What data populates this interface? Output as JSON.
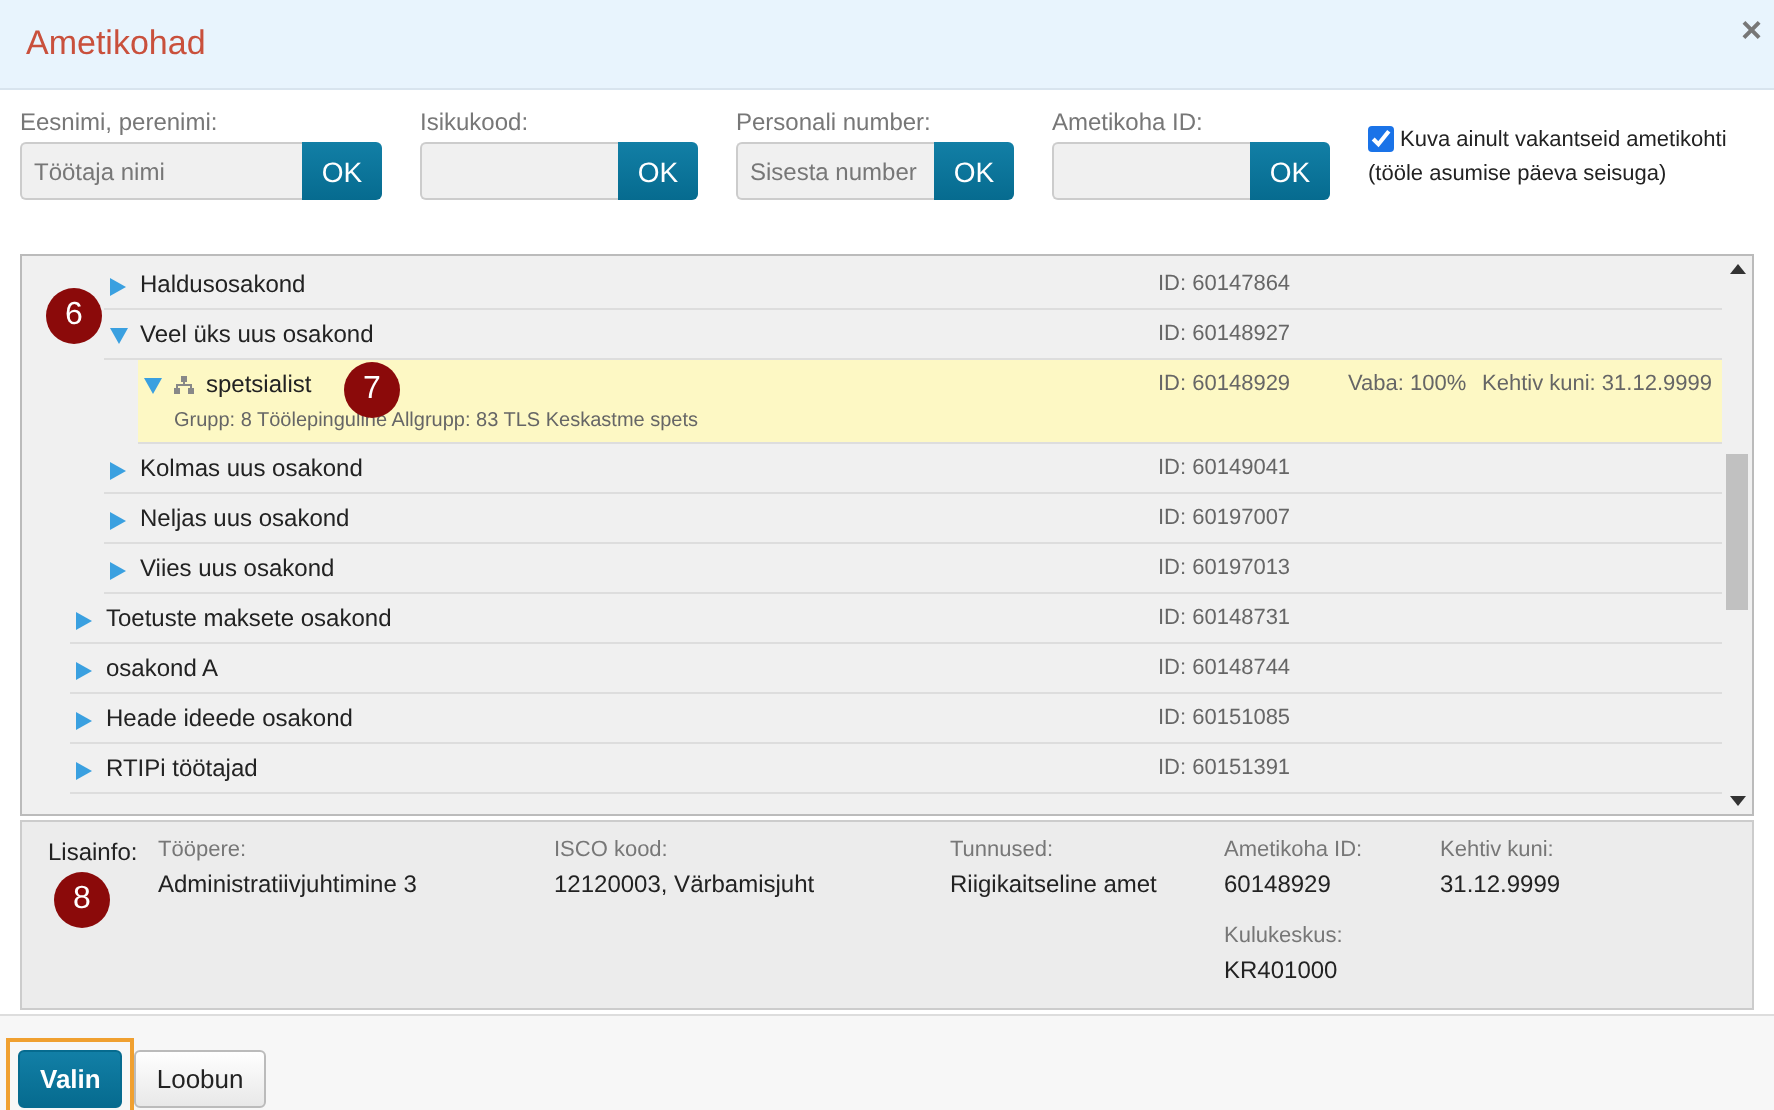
{
  "window": {
    "title": "Ametikohad",
    "close": "×"
  },
  "filters": [
    {
      "label": "Eesnimi, perenimi:",
      "placeholder": "Töötaja nimi",
      "button": "OK"
    },
    {
      "label": "Isikukood:",
      "button": "OK"
    },
    {
      "label": "Personali number:",
      "placeholder": "Sisesta number",
      "button": "OK"
    },
    {
      "label": "Ametikoha ID:",
      "button": "OK"
    }
  ],
  "vacant_only": {
    "label": "Kuva ainult vakantseid ametikohti",
    "note": "(tööle asumise päeva seisuga)",
    "checked": true
  },
  "tree": {
    "continued_items": [
      {
        "kind": "unit",
        "label": "Haldusosakond",
        "id": "ID: 60147864",
        "expanded": false,
        "selected": false
      },
      {
        "kind": "unit",
        "label": "Veel üks uus osakond",
        "id": "ID: 60148927",
        "expanded": true,
        "selected": false,
        "children": [
          {
            "kind": "position",
            "label": "spetsialist",
            "id": "ID: 60148929",
            "vacancy": "Vaba: 100%",
            "valid_until": "Kehtiv kuni: 31.12.9999",
            "details": "Grupp: 8 Töölepinguline Allgrupp: 83 TLS Keskastme spets",
            "expanded": true,
            "selected": true
          }
        ]
      },
      {
        "kind": "unit",
        "label": "Kolmas uus osakond",
        "id": "ID: 60149041",
        "expanded": false,
        "selected": false
      },
      {
        "kind": "unit",
        "label": "Neljas uus osakond",
        "id": "ID: 60197007",
        "expanded": false,
        "selected": false
      },
      {
        "kind": "unit",
        "label": "Viies uus osakond",
        "id": "ID: 60197013",
        "expanded": false,
        "selected": false
      }
    ],
    "items": [
      {
        "kind": "unit",
        "label": "Toetuste maksete osakond",
        "id": "ID: 60148731",
        "expanded": false,
        "selected": false
      },
      {
        "kind": "unit",
        "label": "osakond A",
        "id": "ID: 60148744",
        "expanded": false,
        "selected": false
      },
      {
        "kind": "unit",
        "label": "Heade ideede osakond",
        "id": "ID: 60151085",
        "expanded": false,
        "selected": false
      },
      {
        "kind": "unit",
        "label": "RTIPi töötajad",
        "id": "ID: 60151391",
        "expanded": false,
        "selected": false
      }
    ]
  },
  "info": {
    "label": "Lisainfo:",
    "columns": [
      {
        "fields": [
          {
            "label": "Tööpere:",
            "value": "Administratiivjuhtimine 3"
          }
        ]
      },
      {
        "fields": [
          {
            "label": "ISCO kood:",
            "value": "12120003, Värbamisjuht"
          }
        ]
      },
      {
        "fields": [
          {
            "label": "Tunnused:",
            "value": "Riigikaitseline amet"
          }
        ]
      },
      {
        "fields": [
          {
            "label": "Ametikoha ID:",
            "value": "60148929"
          },
          {
            "label": "Kulukeskus:",
            "value": "KR401000"
          }
        ]
      },
      {
        "fields": [
          {
            "label": "Kehtiv kuni:",
            "value": "31.12.9999"
          }
        ]
      }
    ]
  },
  "markers": [
    "6",
    "7",
    "8"
  ],
  "buttons": [
    {
      "label": "Valin",
      "kind": "primary",
      "focused": true
    },
    {
      "label": "Loobun",
      "kind": "secondary",
      "focused": false
    }
  ]
}
